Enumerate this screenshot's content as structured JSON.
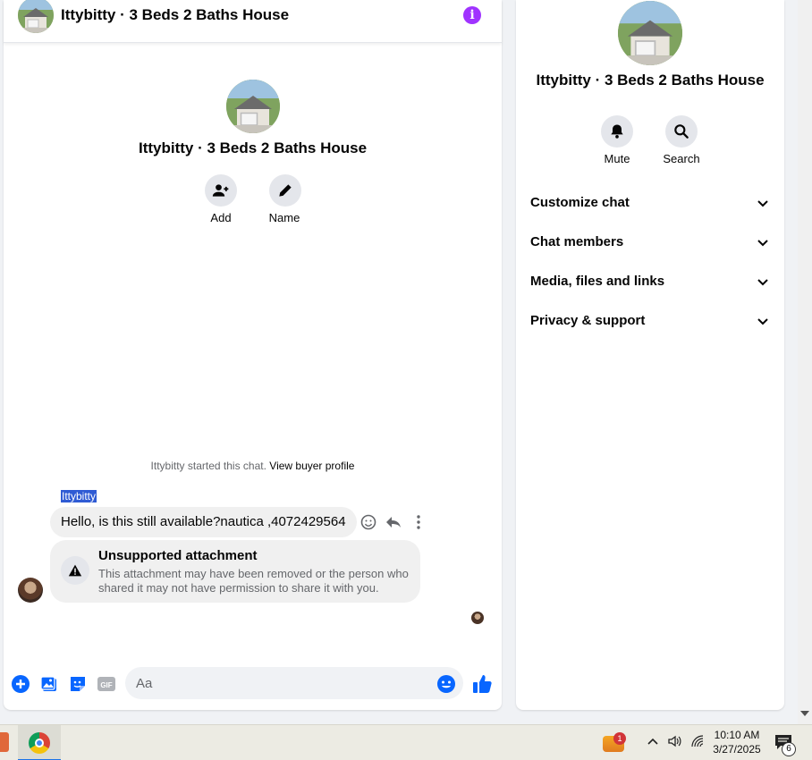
{
  "chat": {
    "title": "Ittybitty · 3 Beds 2 Baths House",
    "info_icon": "info-icon",
    "intro": {
      "title": "Ittybitty · 3 Beds 2 Baths House",
      "add_label": "Add",
      "name_label": "Name"
    },
    "started_text": "Ittybitty started this chat.",
    "buyer_profile_link": "View buyer profile",
    "sender_name": "Ittybitty",
    "message": "Hello, is this still available?nautica ,4072429564",
    "attachment": {
      "title": "Unsupported attachment",
      "body": "This attachment may have been removed or the person who shared it may not have permission to share it with you."
    },
    "composer": {
      "placeholder": "Aa",
      "gif_label": "GIF"
    }
  },
  "details": {
    "title": "Ittybitty · 3 Beds 2 Baths House",
    "mute_label": "Mute",
    "search_label": "Search",
    "sections": [
      "Customize chat",
      "Chat members",
      "Media, files and links",
      "Privacy & support"
    ]
  },
  "taskbar": {
    "time": "10:10 AM",
    "date": "3/27/2025",
    "weather_badge": "1",
    "notification_count": "6"
  },
  "colors": {
    "accent": "#0866ff",
    "info_purple": "#a033ff"
  }
}
